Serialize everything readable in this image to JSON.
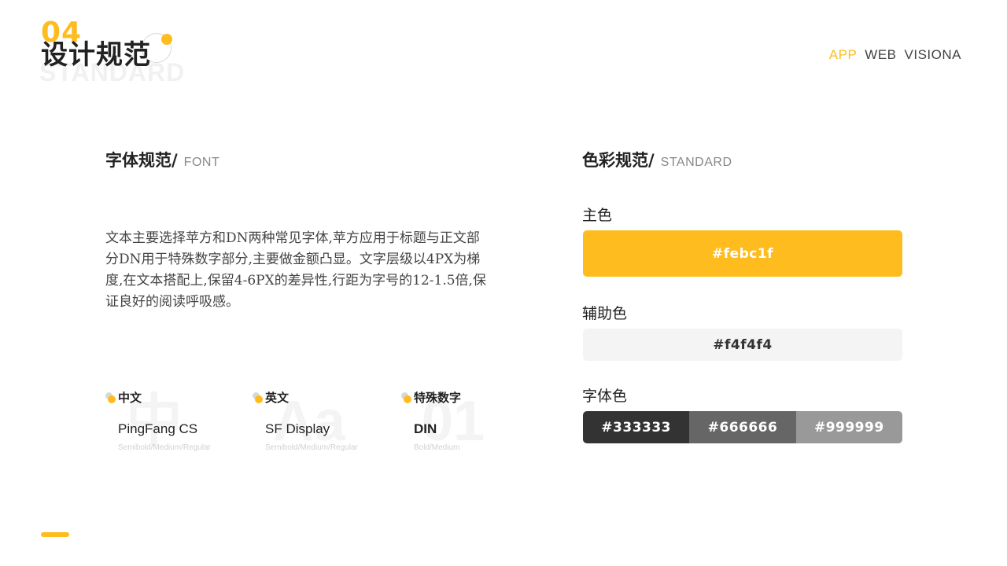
{
  "header": {
    "number": "04",
    "title": "设计规范",
    "subtitle_bg": "STANDARD"
  },
  "nav": [
    "APP",
    "WEB",
    "VISIONA"
  ],
  "font_section": {
    "heading_zh": "字体规范/",
    "heading_en": "FONT",
    "description": "文本主要选择苹方和DN两种常见字体,苹方应用于标题与正文部分DN用于特殊数字部分,主要做金额凸显。文字层级以4PX为梯度,在文本搭配上,保留4-6PX的差异性,行距为字号的12-1.5倍,保证良好的阅读呼吸感。",
    "samples": [
      {
        "bg_char": "中",
        "label": "中文",
        "font": "PingFang CS",
        "weights": "Semibold/Medium/Regular"
      },
      {
        "bg_char": "Aa",
        "label": "英文",
        "font": "SF Display",
        "weights": "Semibold/Medium/Regular"
      },
      {
        "bg_char": "01",
        "label": "特殊数字",
        "font": "DIN",
        "weights": "Bold/Medium"
      }
    ]
  },
  "color_section": {
    "heading_zh": "色彩规范/",
    "heading_en": "STANDARD",
    "primary": {
      "label": "主色",
      "hex": "#febc1f"
    },
    "auxiliary": {
      "label": "辅助色",
      "hex": "#f4f4f4"
    },
    "font_colors": {
      "label": "字体色",
      "values": [
        "#333333",
        "#666666",
        "#999999"
      ]
    }
  },
  "colors": {
    "accent": "#febc1f",
    "light_gray": "#f4f4f4"
  }
}
